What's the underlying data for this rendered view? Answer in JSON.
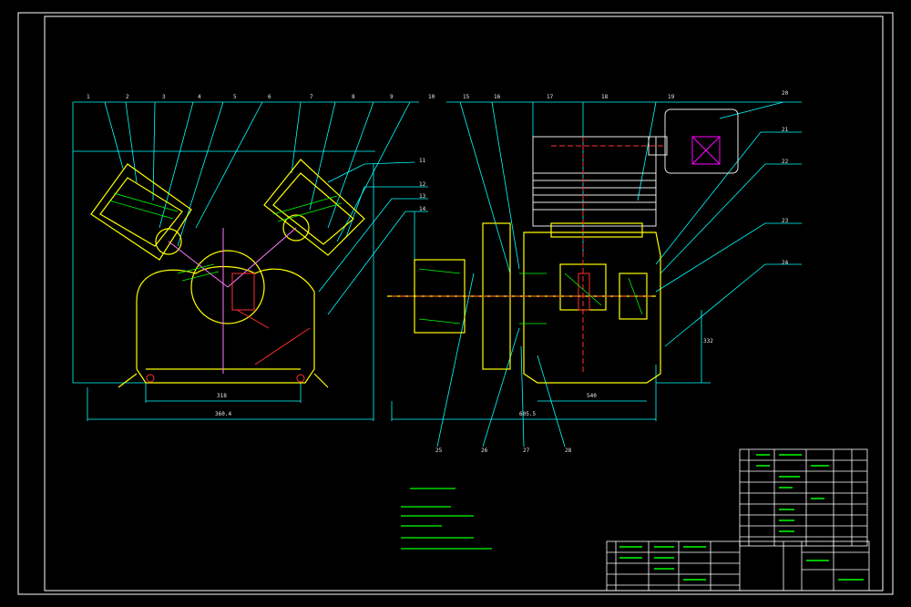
{
  "colors": {
    "background": "#000000",
    "frame": "#ffffff",
    "cyan": "#00ffff",
    "yellow": "#ffff00",
    "green": "#00ff00",
    "red": "#ff3030",
    "magenta": "#ff00ff"
  },
  "drawing": {
    "front_view_callouts": [
      "1",
      "2",
      "3",
      "4",
      "5",
      "6",
      "7",
      "8",
      "9",
      "10",
      "11",
      "12",
      "13",
      "14"
    ],
    "side_view_callouts": [
      "15",
      "16",
      "17",
      "18",
      "19",
      "20",
      "21",
      "22",
      "23",
      "24",
      "25",
      "26",
      "27",
      "28"
    ],
    "dimensions": {
      "front_width_inner": "318",
      "front_width_outer": "360.4",
      "side_width_inner": "540",
      "side_width_outer": "605.5",
      "side_height": "332"
    }
  }
}
